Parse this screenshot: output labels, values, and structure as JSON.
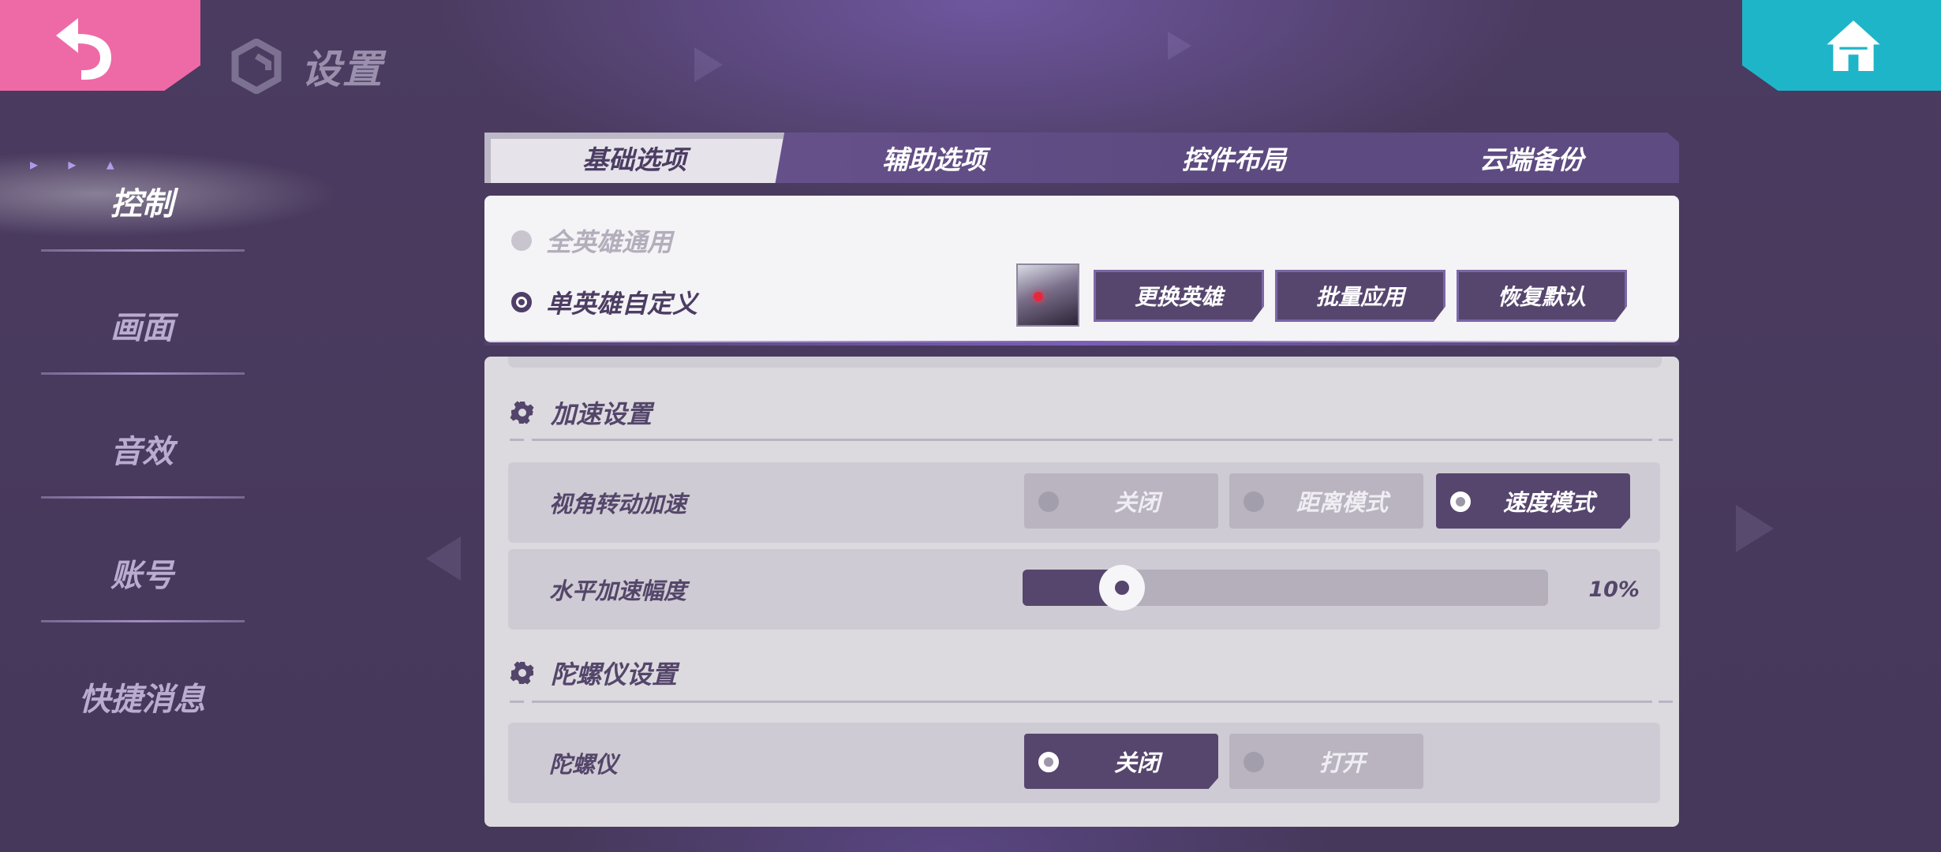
{
  "header": {
    "title": "设置",
    "back_icon": "back-arrow-icon",
    "home_icon": "home-icon",
    "colors": {
      "back": "#ee6aa6",
      "home": "#1fb5c8",
      "accent": "#56466e"
    }
  },
  "nav": {
    "items": [
      {
        "label": "控制",
        "active": true
      },
      {
        "label": "画面"
      },
      {
        "label": "音效"
      },
      {
        "label": "账号"
      },
      {
        "label": "快捷消息"
      }
    ]
  },
  "tabs": [
    {
      "label": "基础选项",
      "active": true
    },
    {
      "label": "辅助选项"
    },
    {
      "label": "控件布局"
    },
    {
      "label": "云端备份"
    }
  ],
  "hero": {
    "option_all": "全英雄通用",
    "option_single": "单英雄自定义",
    "selected": "单英雄自定义",
    "buttons": {
      "change": "更换英雄",
      "batch": "批量应用",
      "reset": "恢复默认"
    }
  },
  "accel": {
    "title": "加速设置",
    "view_label": "视角转动加速",
    "view_options": [
      "关闭",
      "距离模式",
      "速度模式"
    ],
    "view_selected": "速度模式",
    "h_label": "水平加速幅度",
    "h_value_text": "10%",
    "h_value": 0.1
  },
  "gyro": {
    "title": "陀螺仪设置",
    "label": "陀螺仪",
    "options": [
      "关闭",
      "打开"
    ],
    "selected": "关闭"
  }
}
